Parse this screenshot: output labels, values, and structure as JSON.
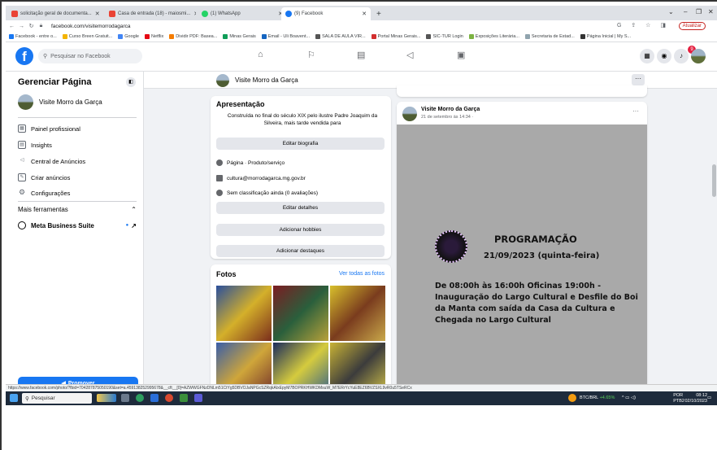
{
  "browser": {
    "tabs": [
      {
        "title": "solicitação geral de documenta...",
        "color": "#ea4335"
      },
      {
        "title": "Casa de entrada (18) - maiosmi...",
        "color": "#ea4335"
      },
      {
        "title": "(1) WhatsApp",
        "color": "#25d366"
      },
      {
        "title": "(9) Facebook",
        "color": "#1877f2"
      }
    ],
    "new_tab": "+",
    "url": "facebook.com/visitemorrodagarca",
    "update_label": "Atualizar",
    "bookmarks": [
      {
        "label": "Facebook - entre o...",
        "color": "#1877f2"
      },
      {
        "label": "Curso Breen Gratuit...",
        "color": "#f4b400"
      },
      {
        "label": "Google",
        "color": "#4285f4"
      },
      {
        "label": "Netflix",
        "color": "#e50914"
      },
      {
        "label": "Dividir PDF: Basea...",
        "color": "#f57c00"
      },
      {
        "label": "Minas Gerais",
        "color": "#0f9d58"
      },
      {
        "label": "Email - Uli Boavent...",
        "color": "#1565c0"
      },
      {
        "label": "SALA DE AULA VIR...",
        "color": "#555555"
      },
      {
        "label": "Portal Minas Gerais...",
        "color": "#d32f2f"
      },
      {
        "label": "SIC-TUR Login",
        "color": "#555555"
      },
      {
        "label": "Exposições Literária...",
        "color": "#7cb342"
      },
      {
        "label": "Secretaria de Estad...",
        "color": "#90a4ae"
      },
      {
        "label": "Página Inicial | My S...",
        "color": "#333333"
      }
    ]
  },
  "facebook": {
    "search_placeholder": "Pesquisar no Facebook",
    "notification_count": "9"
  },
  "sidebar": {
    "title": "Gerenciar Página",
    "page_name": "Visite Morro da Garça",
    "items": [
      {
        "label": "Painel profissional"
      },
      {
        "label": "Insights"
      },
      {
        "label": "Central de Anúncios"
      },
      {
        "label": "Criar anúncios"
      },
      {
        "label": "Configurações"
      }
    ],
    "more_tools": "Mais ferramentas",
    "meta_suite": "Meta Business Suite",
    "promote": "Promover"
  },
  "page_header": {
    "name": "Visite Morro da Garça",
    "more": "···"
  },
  "about": {
    "title": "Apresentação",
    "bio": "Construída no final do século XIX pelo ilustre Padre Joaquim da Silveira, mais tarde vendida para",
    "edit_bio": "Editar biografia",
    "category": "Página · Produto/serviço",
    "email": "cultura@morrodagarca.mg.gov.br",
    "rating": "Sem classificação ainda (0 avaliações)",
    "edit_details": "Editar detalhes",
    "add_hobbies": "Adicionar hobbies",
    "add_highlights": "Adicionar destaques"
  },
  "photos": {
    "title": "Fotos",
    "see_all": "Ver todas as fotos"
  },
  "post": {
    "author": "Visite Morro da Garça",
    "date": "21 de setembro às 14:34 · ",
    "heading": "PROGRAMAÇÃO",
    "event_date": "21/09/2023 (quinta-feira)",
    "body": "De 08:00h às 16:00h Oficinas 19:00h - Inauguração do Largo Cultural e Desfile do Boi da Manta com saída da Casa da Cultura e Chegada no Largo Cultural"
  },
  "status_url": "https://www.facebook.com/photo/?fbid=704287875050190&set=a.459138252995678&__cft__[0]=AZWWGFNzDNLm51CtYg5DBVOJaNPGcSZRqkAIxEpyM7BOPRKHWKDMsuW_M7ERrYcYuE8EZ6BVZSXL9vR0u5TSeRCx",
  "taskbar": {
    "search": "Pesquisar",
    "btc_label": "BTC/BRL",
    "btc_change": "+4.65%",
    "lang": "POR",
    "layout": "PTB2",
    "time": "08:12",
    "date": "02/10/2023"
  }
}
